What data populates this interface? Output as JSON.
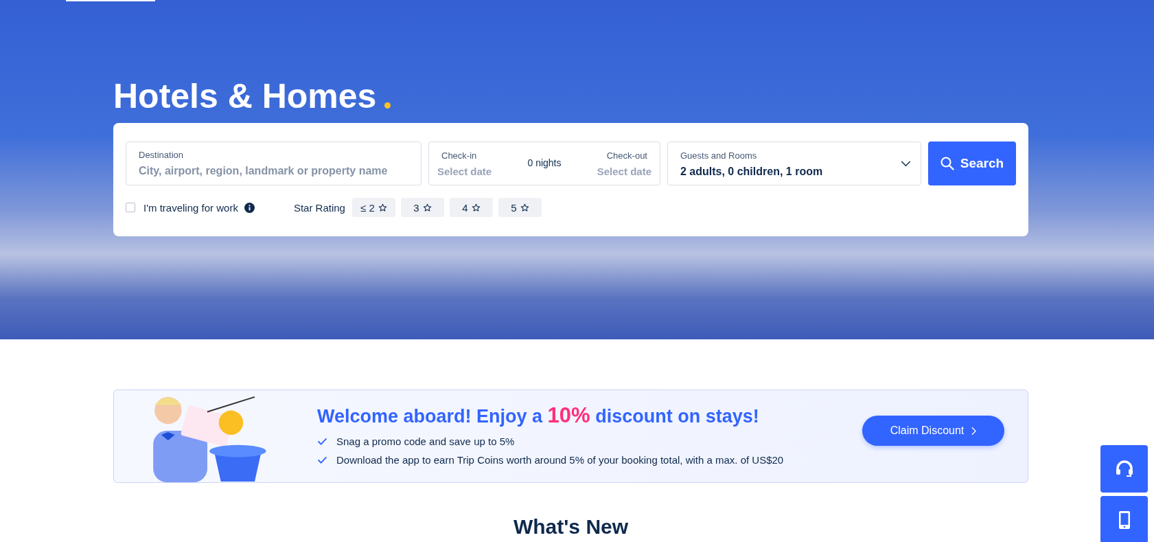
{
  "hero": {
    "title": "Hotels & Homes"
  },
  "search": {
    "destination": {
      "label": "Destination",
      "placeholder": "City, airport, region, landmark or property name"
    },
    "checkin": {
      "label": "Check-in",
      "placeholder": "Select date"
    },
    "nights": "0 nights",
    "checkout": {
      "label": "Check-out",
      "placeholder": "Select date"
    },
    "guests": {
      "label": "Guests and Rooms",
      "value": "2 adults, 0 children, 1 room"
    },
    "button": "Search",
    "work_trip": {
      "label": "I'm traveling for work",
      "checked": false
    },
    "star_rating": {
      "label": "Star Rating",
      "options": [
        {
          "label": "≤ 2",
          "selected": false
        },
        {
          "label": "3",
          "selected": false
        },
        {
          "label": "4",
          "selected": false
        },
        {
          "label": "5",
          "selected": false
        }
      ]
    }
  },
  "promo": {
    "title_start": "Welcome aboard! Enjoy a ",
    "title_highlight": "10%",
    "title_end": " discount on stays!",
    "points": [
      "Snag a promo code and save up to 5%",
      "Download the app to earn Trip Coins worth around 5% of your booking total, with a max. of US$20"
    ],
    "button": "Claim Discount"
  },
  "section_title": "What's New"
}
